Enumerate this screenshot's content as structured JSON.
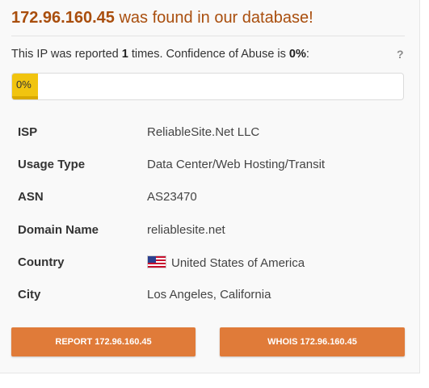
{
  "header": {
    "ip": "172.96.160.45",
    "found_text": " was found in our database!"
  },
  "report": {
    "prefix": "This IP was reported ",
    "count": "1",
    "middle": " times. Confidence of Abuse is ",
    "confidence": "0%",
    "suffix": ":",
    "help_label": "?"
  },
  "progress": {
    "label": "0%",
    "value_percent": 0,
    "fill_color": "#f1c40f"
  },
  "details": [
    {
      "label": "ISP",
      "value": "ReliableSite.Net LLC"
    },
    {
      "label": "Usage Type",
      "value": "Data Center/Web Hosting/Transit"
    },
    {
      "label": "ASN",
      "value": "AS23470"
    },
    {
      "label": "Domain Name",
      "value": "reliablesite.net"
    },
    {
      "label": "Country",
      "value": "United States of America",
      "icon": "us-flag-icon"
    },
    {
      "label": "City",
      "value": "Los Angeles, California"
    }
  ],
  "buttons": {
    "report_label": "REPORT 172.96.160.45",
    "whois_label": "WHOIS 172.96.160.45"
  },
  "colors": {
    "title": "#a94e0d",
    "button": "#e07b39"
  }
}
